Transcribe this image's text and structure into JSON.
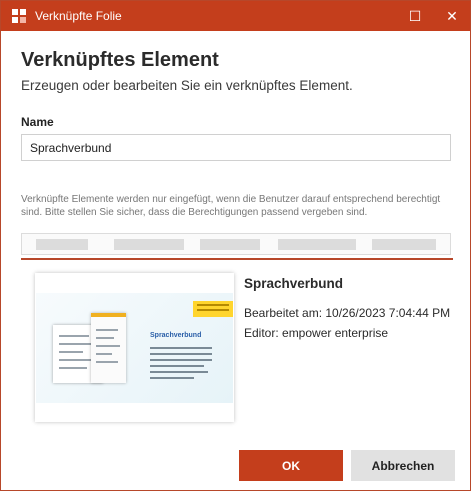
{
  "window": {
    "title": "Verknüpfte Folie",
    "maximize_glyph": "☐",
    "close_glyph": "✕"
  },
  "header": {
    "heading": "Verknüpftes Element",
    "subheading": "Erzeugen oder bearbeiten Sie ein verknüpftes Element."
  },
  "name_field": {
    "label": "Name",
    "value": "Sprachverbund"
  },
  "notice": "Verknüpfte Elemente werden nur eingefügt, wenn die Benutzer darauf entsprechend berechtigt sind. Bitte stellen Sie sicher, dass die Berechtigungen passend vergeben sind.",
  "linked_item": {
    "title": "Sprachverbund",
    "edited": "Bearbeitet am: 10/26/2023 7:04:44 PM",
    "editor": "Editor: empower enterprise",
    "thumbnail_title": "Sprachverbund"
  },
  "buttons": {
    "ok": "OK",
    "cancel": "Abbrechen"
  },
  "colors": {
    "accent": "#c43e1c",
    "button_secondary": "#e1e1e1"
  },
  "icons": {
    "app": "powerpoint-link-icon",
    "maximize": "maximize-icon",
    "close": "close-icon"
  }
}
